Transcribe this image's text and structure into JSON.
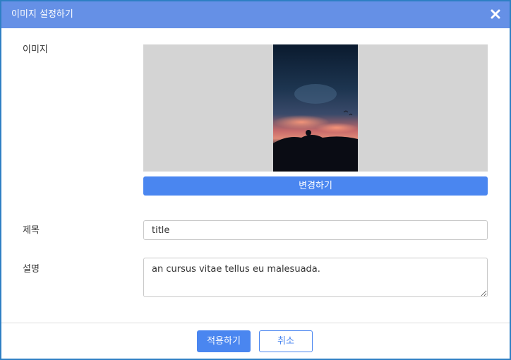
{
  "dialog": {
    "title": "이미지 설정하기",
    "close_icon": "close-icon"
  },
  "form": {
    "image_label": "이미지",
    "change_button": "변경하기",
    "title_label": "제목",
    "title_value": "title",
    "description_label": "설명",
    "description_value": "an cursus vitae tellus eu malesuada."
  },
  "footer": {
    "apply_button": "적용하기",
    "cancel_button": "취소"
  },
  "colors": {
    "titlebar": "#6590e6",
    "primary": "#4a86f0",
    "image_background": "#d4d4d4"
  }
}
